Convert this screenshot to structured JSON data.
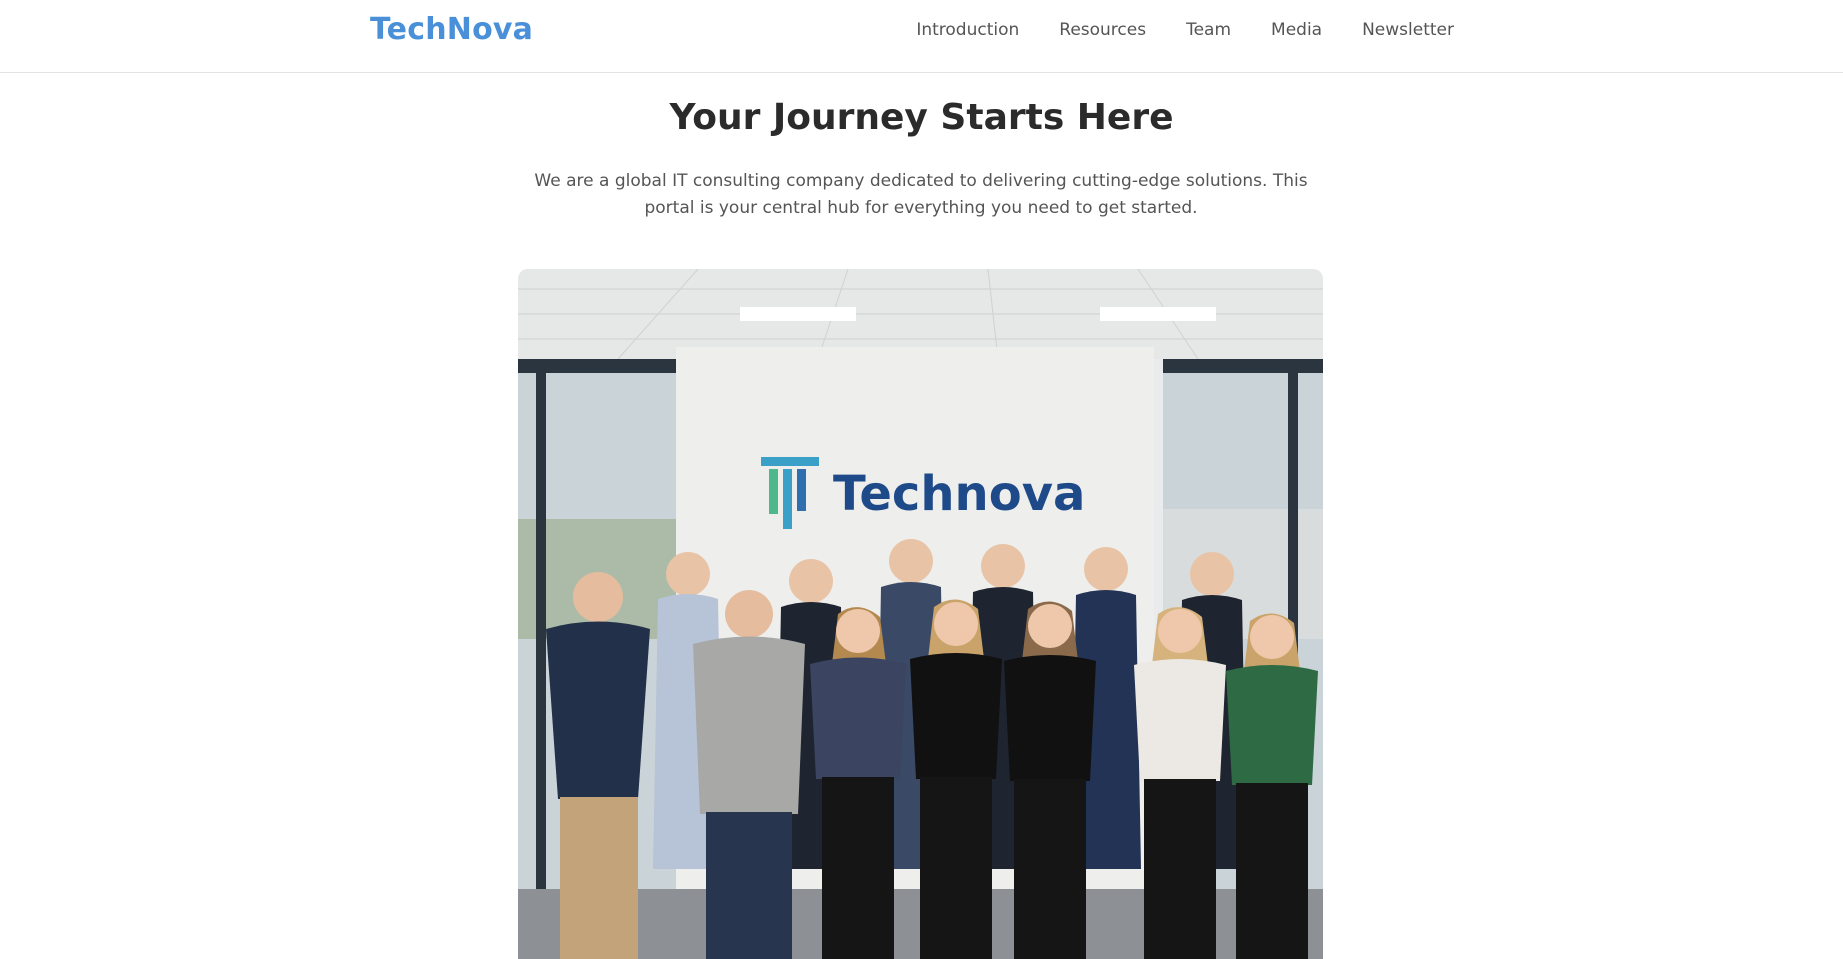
{
  "navbar": {
    "logo": "TechNova",
    "links": [
      "Introduction",
      "Resources",
      "Team",
      "Media",
      "Newsletter"
    ]
  },
  "hero": {
    "title": "Your Journey Starts Here",
    "description": "We are a global IT consulting company dedicated to delivering cutting-edge solutions. This portal is your central hub for everything you need to get started.",
    "image": {
      "wall_logo_text": "Technova",
      "people_count": 15
    }
  },
  "colors": {
    "brand": "#4a90d9",
    "heading": "#2b2b2b",
    "body_text": "#555555",
    "wall_logo": "#1f4a8a"
  }
}
